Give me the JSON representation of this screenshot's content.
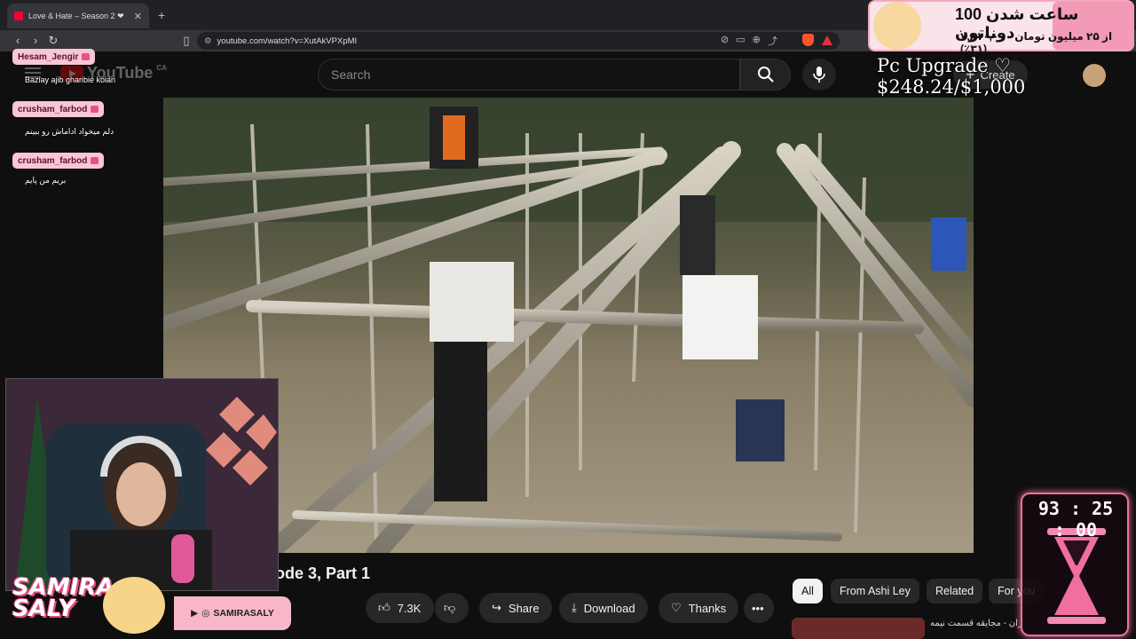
{
  "browser": {
    "tab_title": "Love & Hate – Season 2 ❤ ",
    "url": "youtube.com/watch?v=XutAkVPXpMI"
  },
  "youtube": {
    "logo_text": "YouTube",
    "country_code": "CA",
    "search_placeholder": "Search",
    "create_label": "Create",
    "video_title": "ode 3, Part 1",
    "actions": {
      "likes": "7.3K",
      "share": "Share",
      "download": "Download",
      "thanks": "Thanks"
    },
    "chips": [
      "All",
      "From Ashi Ley",
      "Related",
      "For you"
    ],
    "rec_title": "ران - مجایقه قسمت نیمه"
  },
  "chat": [
    {
      "user": "Hesam_Jengir",
      "message": "Baziay ajib gharibie kolan"
    },
    {
      "user": "crusham_farbod",
      "message": "دلم میخواد اداماش رو ببینم"
    },
    {
      "user": "crusham_farbod",
      "message": "بریم من پایم"
    }
  ],
  "donation": {
    "title": "100 ساعت شدن دوناتون",
    "progress": "۷,۸۱۰,۰۰۰ از ۲۵ میلیون تومان (۳۱٪)",
    "goal_text": "Pc Upgrade ♡ $248.24/$1,000"
  },
  "streamer": {
    "brand_line1": "SAMIRA",
    "brand_line2": "SALY",
    "social_handle": "SAMIRASALY"
  },
  "timer": {
    "value": "93 : 25 : 00"
  },
  "colors": {
    "yt_red": "#ff0000",
    "accent_pink": "#f06fa0",
    "bg": "#0f0f0f"
  }
}
